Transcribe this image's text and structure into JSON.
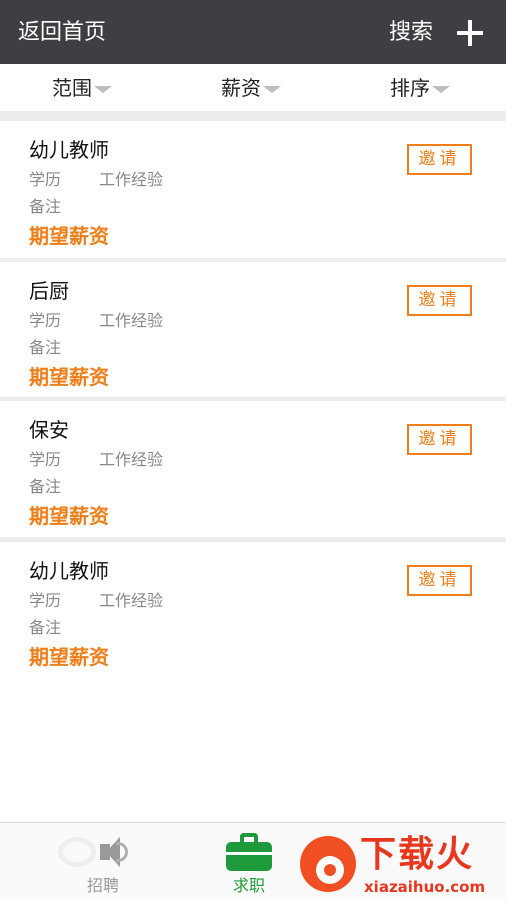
{
  "header": {
    "back_label": "返回首页",
    "search_label": "搜索",
    "add_icon": "plus-icon"
  },
  "filters": [
    {
      "label": "范围"
    },
    {
      "label": "薪资"
    },
    {
      "label": "排序"
    }
  ],
  "list": {
    "items": [
      {
        "title": "幼儿教师",
        "education_label": "学历",
        "experience_label": "工作经验",
        "note_label": "备注",
        "salary_label": "期望薪资",
        "invite_label": "邀请"
      },
      {
        "title": "后厨",
        "education_label": "学历",
        "experience_label": "工作经验",
        "note_label": "备注",
        "salary_label": "期望薪资",
        "invite_label": "邀请"
      },
      {
        "title": "保安",
        "education_label": "学历",
        "experience_label": "工作经验",
        "note_label": "备注",
        "salary_label": "期望薪资",
        "invite_label": "邀请"
      },
      {
        "title": "幼儿教师",
        "education_label": "学历",
        "experience_label": "工作经验",
        "note_label": "备注",
        "salary_label": "期望薪资",
        "invite_label": "邀请"
      }
    ]
  },
  "tabbar": {
    "tabs": [
      {
        "label": "招聘",
        "icon": "speaker-icon",
        "active": false
      },
      {
        "label": "求职",
        "icon": "briefcase-icon",
        "active": true
      }
    ]
  },
  "watermark": {
    "brand": "下载火",
    "domain": "xiazaihuo.com"
  },
  "colors": {
    "header_bg": "#3d3f43",
    "accent_orange": "#ef7f1a",
    "active_green": "#1f9a3a",
    "list_bg": "#ededed"
  }
}
